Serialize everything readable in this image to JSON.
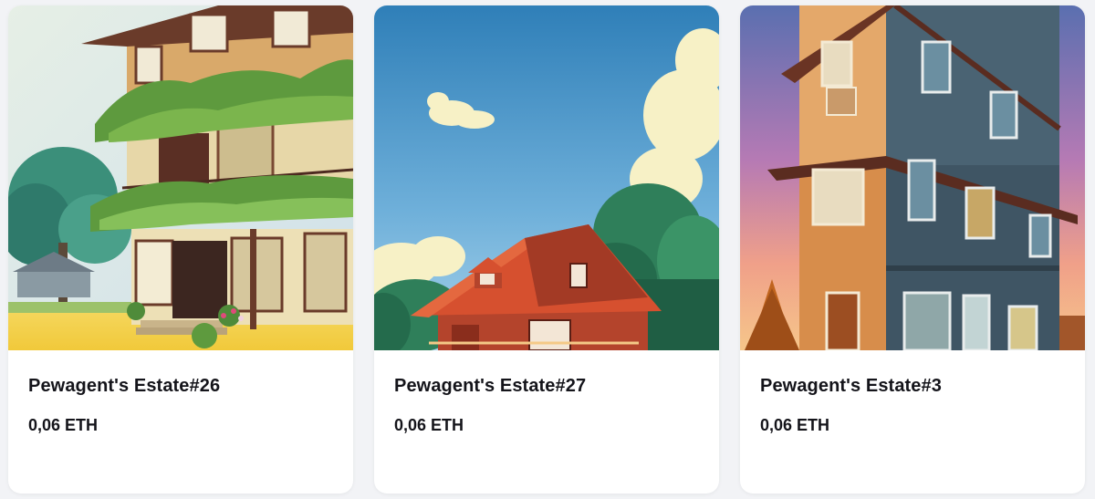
{
  "listings": [
    {
      "name": "Pewagent's Estate#26",
      "price": "0,06 ETH",
      "image": "two-story house with vine-covered balconies beside a large tree"
    },
    {
      "name": "Pewagent's Estate#27",
      "price": "0,06 ETH",
      "image": "red-roofed cottage under blue sky with clouds and trees"
    },
    {
      "name": "Pewagent's Estate#3",
      "price": "0,06 ETH",
      "image": "tall wooden townhouse at sunset with pine tree"
    }
  ],
  "colors": {
    "page_background": "#f2f3f6",
    "card_background": "#ffffff",
    "text": "#14141a"
  }
}
